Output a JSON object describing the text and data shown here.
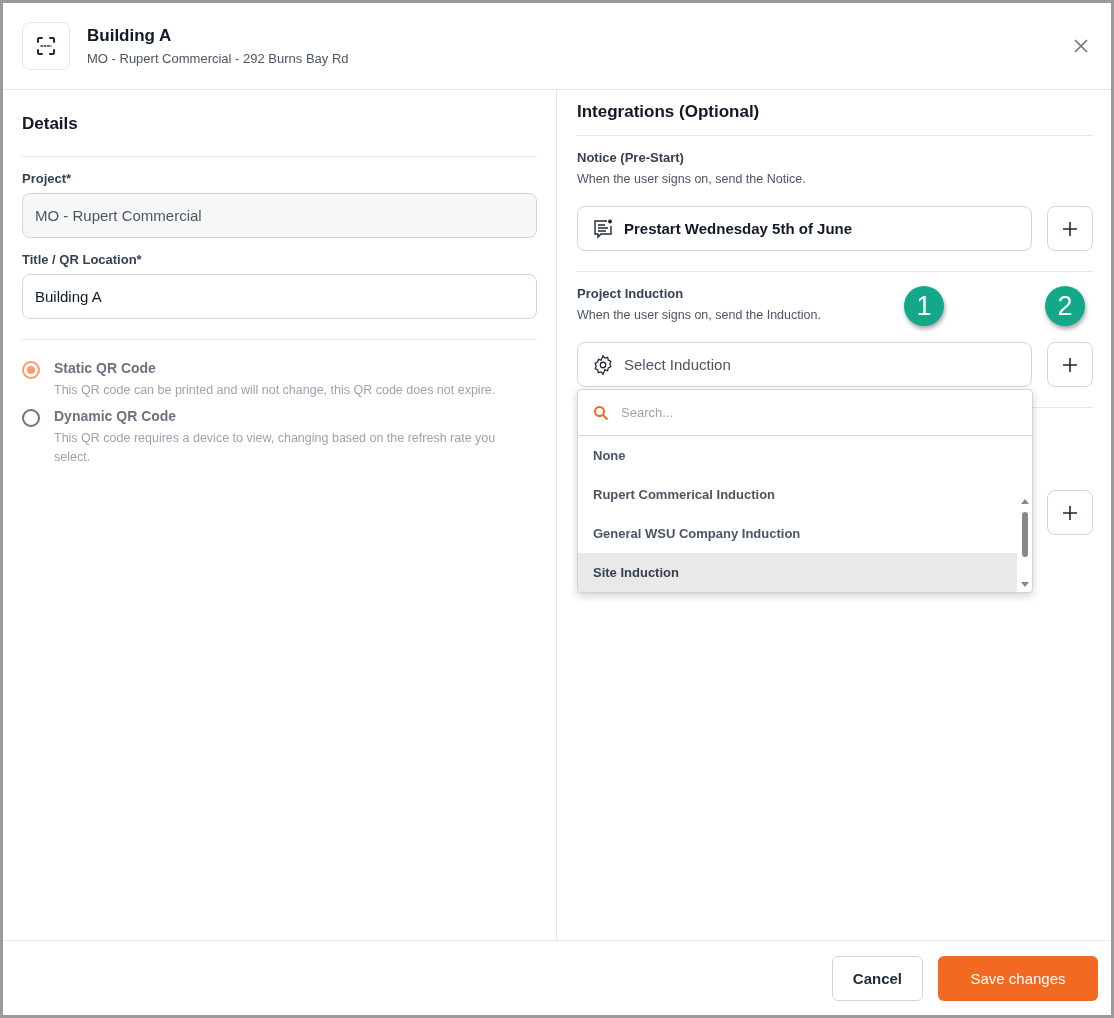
{
  "header": {
    "title": "Building A",
    "subtitle": "MO - Rupert Commercial - 292 Burns Bay Rd"
  },
  "details": {
    "heading": "Details",
    "fields": [
      {
        "label": "Project*",
        "value": "MO - Rupert Commercial",
        "disabled": true
      },
      {
        "label": "Title / QR Location*",
        "value": "Building A",
        "disabled": false
      }
    ],
    "qr_options": [
      {
        "label": "Static QR Code",
        "description": "This QR code can be printed and will not change, this QR code does not expire.",
        "selected": true
      },
      {
        "label": "Dynamic QR Code",
        "description": "This QR code requires a device to view, changing based on the refresh rate you select.",
        "selected": false
      }
    ]
  },
  "integrations": {
    "heading": "Integrations (Optional)",
    "notice": {
      "title": "Notice (Pre-Start)",
      "description": "When the user signs on, send the Notice.",
      "value": "Prestart Wednesday 5th of June"
    },
    "induction": {
      "title": "Project Induction",
      "description": "When the user signs on, send the Induction.",
      "placeholder": "Select Induction",
      "dropdown": {
        "search_placeholder": "Search...",
        "options": [
          {
            "label": "None",
            "selected": false
          },
          {
            "label": "Rupert Commerical Induction",
            "selected": false
          },
          {
            "label": "General WSU Company Induction",
            "selected": false
          },
          {
            "label": "Site Induction",
            "selected": true
          }
        ]
      }
    },
    "markers": [
      "1",
      "2"
    ]
  },
  "footer": {
    "cancel": "Cancel",
    "save": "Save changes"
  }
}
